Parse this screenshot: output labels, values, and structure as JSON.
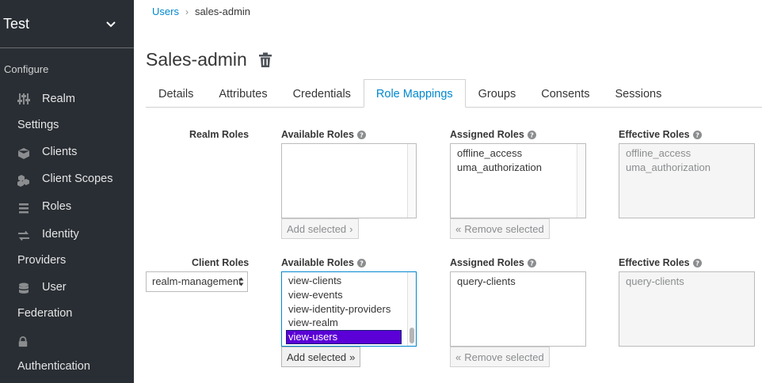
{
  "sidebar": {
    "realm": "Test",
    "section": "Configure",
    "items": [
      {
        "line1": "Realm",
        "line2": "Settings",
        "icon": "sliders-icon"
      },
      {
        "line1": "Clients",
        "line2": "",
        "icon": "cube-icon"
      },
      {
        "line1": "Client Scopes",
        "line2": "",
        "icon": "cubes-icon"
      },
      {
        "line1": "Roles",
        "line2": "",
        "icon": "list-icon"
      },
      {
        "line1": "Identity",
        "line2": "Providers",
        "icon": "exchange-icon"
      },
      {
        "line1": "User",
        "line2": "Federation",
        "icon": "database-icon"
      },
      {
        "line1": "",
        "line2": "Authentication",
        "icon": "lock-icon"
      }
    ]
  },
  "breadcrumb": {
    "parent": "Users",
    "current": "sales-admin"
  },
  "page": {
    "title": "Sales-admin"
  },
  "tabs": [
    {
      "label": "Details"
    },
    {
      "label": "Attributes"
    },
    {
      "label": "Credentials"
    },
    {
      "label": "Role Mappings",
      "active": true
    },
    {
      "label": "Groups"
    },
    {
      "label": "Consents"
    },
    {
      "label": "Sessions"
    }
  ],
  "realm_roles": {
    "label": "Realm Roles",
    "available_label": "Available Roles",
    "assigned_label": "Assigned Roles",
    "effective_label": "Effective Roles",
    "available": [],
    "assigned": [
      "offline_access",
      "uma_authorization"
    ],
    "effective": [
      "offline_access",
      "uma_authorization"
    ],
    "add_button": "Add selected",
    "remove_button": "Remove selected"
  },
  "client_roles": {
    "label": "Client Roles",
    "select_value": "realm-management",
    "available_label": "Available Roles",
    "assigned_label": "Assigned Roles",
    "effective_label": "Effective Roles",
    "available": [
      "view-clients",
      "view-events",
      "view-identity-providers",
      "view-realm",
      "view-users"
    ],
    "selected": "view-users",
    "assigned": [
      "query-clients"
    ],
    "effective": [
      "query-clients"
    ],
    "add_button": "Add selected",
    "remove_button": "Remove selected"
  },
  "colors": {
    "sidebar_bg": "#292e34",
    "link": "#0088ce",
    "selection": "#5b00d6"
  }
}
